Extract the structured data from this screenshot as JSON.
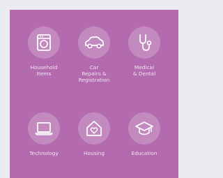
{
  "colors": {
    "background": "#e9ebef",
    "panel": "#b36aae",
    "icon_circle": "rgba(255,255,255,0.22)",
    "text": "#f3e6f2"
  },
  "categories": [
    {
      "label": "Household\nItems",
      "icon": "washing-machine-icon"
    },
    {
      "label": "Car\nRepairs &\nRegistration",
      "icon": "car-icon"
    },
    {
      "label": "Medical\n& Dental",
      "icon": "stethoscope-icon"
    },
    {
      "label": "Technology",
      "icon": "laptop-icon"
    },
    {
      "label": "Housing",
      "icon": "house-heart-icon"
    },
    {
      "label": "Education",
      "icon": "graduation-cap-icon"
    }
  ]
}
